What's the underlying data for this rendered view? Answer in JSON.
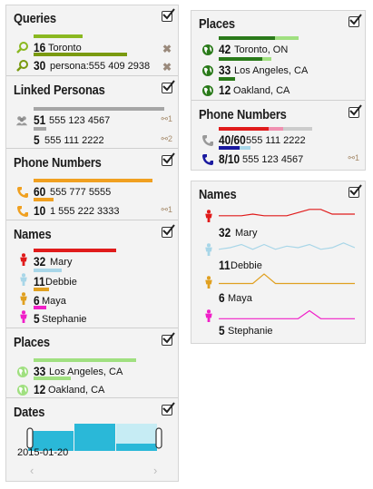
{
  "colors": {
    "green": "#8ab820",
    "olive": "#7a9a10",
    "gray": "#a5a5a5",
    "orange": "#f0a020",
    "red": "#e01b1b",
    "lightblue": "#a8d6e8",
    "gold": "#e0a020",
    "magenta": "#f020c8",
    "lightgreen": "#a0e080",
    "darkgreen": "#2a7a1a",
    "cyan": "#2ab8d8"
  },
  "queries": {
    "title": "Queries",
    "items": [
      {
        "count": "16",
        "label": "Toronto",
        "icon": "search-icon",
        "bar_fraction": 0.25
      },
      {
        "count": "30",
        "label": "persona:555 409 2938",
        "icon": "search-icon",
        "bar_fraction": 0.47
      }
    ]
  },
  "linked_personas": {
    "title": "Linked Personas",
    "items": [
      {
        "count": "51",
        "label": "555 123 4567",
        "link_count": "1",
        "bar_fraction": 0.9
      },
      {
        "count": "5",
        "label": "555 111 2222",
        "link_count": "2",
        "bar_fraction": 0.09
      }
    ]
  },
  "phone_numbers_left": {
    "title": "Phone Numbers",
    "items": [
      {
        "count": "60",
        "label": "555 777 5555",
        "link_count": "",
        "bar_fraction": 0.85
      },
      {
        "count": "10",
        "label": "1 555 222 3333",
        "link_count": "1",
        "bar_fraction": 0.14
      }
    ]
  },
  "names_left": {
    "title": "Names",
    "items": [
      {
        "count": "32",
        "label": "Mary",
        "bar_fraction": 0.46
      },
      {
        "count": "11",
        "label": "Debbie",
        "bar_fraction": 0.16
      },
      {
        "count": "6",
        "label": "Maya",
        "bar_fraction": 0.09
      },
      {
        "count": "5",
        "label": "Stephanie",
        "bar_fraction": 0.07
      }
    ]
  },
  "places_left": {
    "title": "Places",
    "items": [
      {
        "count": "33",
        "label": "Los Angeles, CA",
        "bar_fraction": 0.79
      },
      {
        "count": "12",
        "label": "Oakland, CA",
        "bar_fraction": 0.29
      }
    ]
  },
  "dates": {
    "title": "Dates",
    "start_label": "2015-01-20",
    "nav_left": "‹",
    "nav_right": "›"
  },
  "places_right": {
    "title": "Places",
    "items": [
      {
        "count": "42",
        "label": "Toronto, ON",
        "bar_fraction": 0.68
      },
      {
        "count": "33",
        "label": "Los Angeles, CA",
        "bar_fraction": 0.53
      },
      {
        "count": "12",
        "label": "Oakland, CA",
        "bar_fraction": 0.19
      }
    ]
  },
  "phone_numbers_right": {
    "title": "Phone Numbers",
    "items": [
      {
        "count": "40/60",
        "label": "555 111 2222",
        "link_count": "",
        "bar_fraction": 0.67
      },
      {
        "count": "8/10",
        "label": "555 123 4567",
        "link_count": "1",
        "bar_fraction": 0.8
      }
    ]
  },
  "names_right": {
    "title": "Names",
    "items": [
      {
        "count": "32",
        "label": "Mary",
        "series": [
          3,
          3,
          3,
          4,
          3,
          3,
          3,
          5,
          7,
          7,
          4,
          4,
          4
        ]
      },
      {
        "count": "11",
        "label": "Debbie",
        "series": [
          3,
          4,
          6,
          3,
          6,
          3,
          5,
          4,
          6,
          3,
          4,
          7,
          4
        ]
      },
      {
        "count": "6",
        "label": "Maya",
        "series": [
          2,
          2,
          2,
          2,
          8,
          2,
          2,
          2,
          2,
          2,
          2,
          2,
          2
        ]
      },
      {
        "count": "5",
        "label": "Stephanie",
        "series": [
          1,
          1,
          1,
          1,
          1,
          1,
          1,
          1,
          6,
          1,
          1,
          1,
          1
        ]
      }
    ]
  }
}
